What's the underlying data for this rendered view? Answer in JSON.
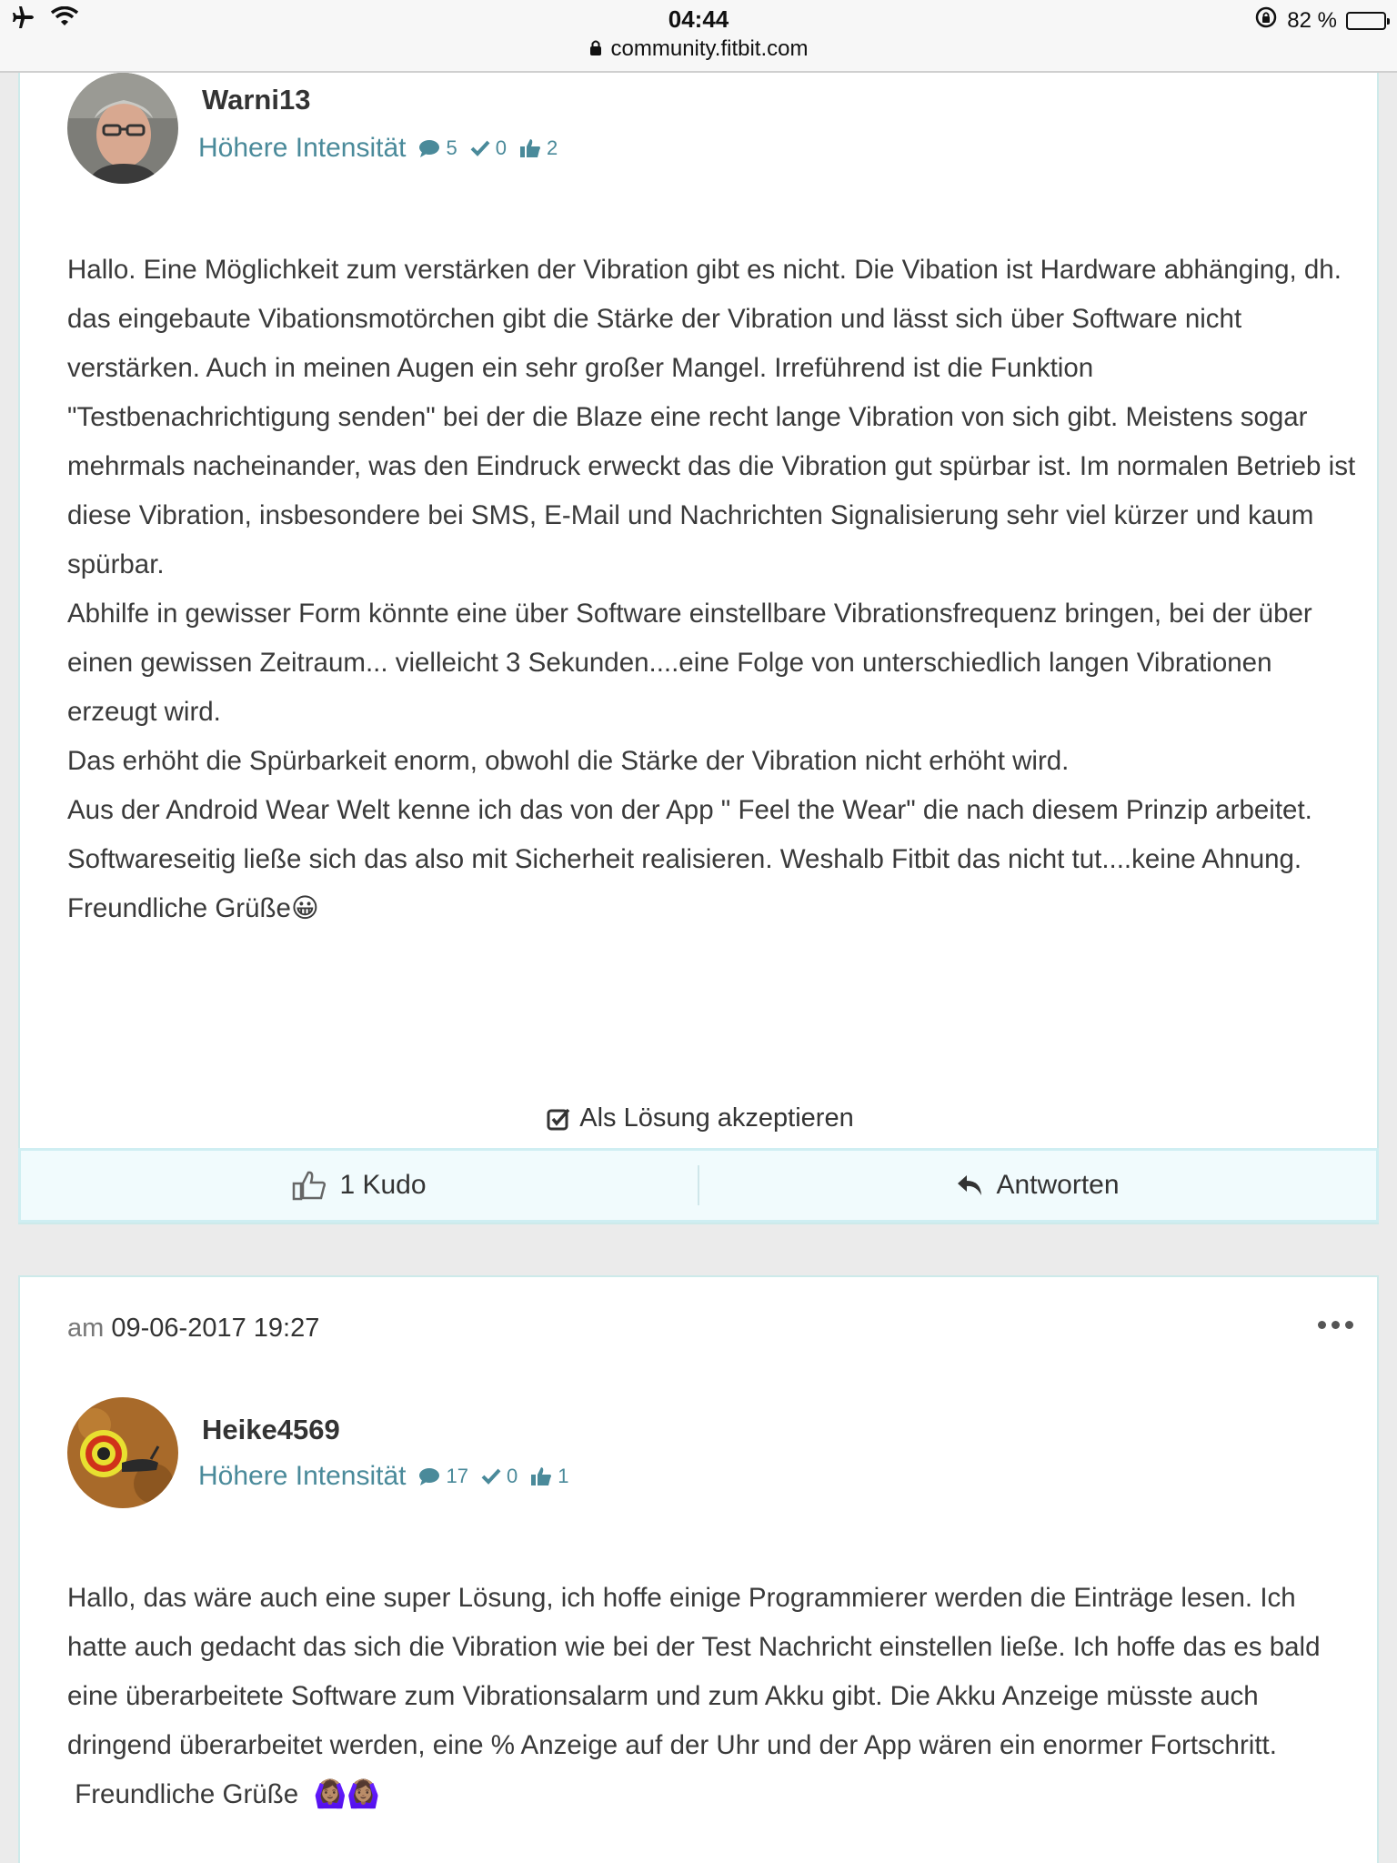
{
  "status_bar": {
    "time": "04:44",
    "url": "community.fitbit.com",
    "battery": "82 %",
    "battery_level": 0.82
  },
  "post1": {
    "username": "Warni13",
    "rank": "Höhere Intensität",
    "stats": {
      "messages": "5",
      "solutions": "0",
      "kudos": "2"
    },
    "body": [
      "Hallo. Eine Möglichkeit zum verstärken der Vibration gibt es nicht. Die Vibation ist Hardware abhänging, dh. das eingebaute Vibationsmotörchen gibt die Stärke der Vibration und lässt sich über Software nicht verstärken. Auch in meinen Augen ein sehr großer Mangel. Irreführend ist die Funktion \"Testbenachrichtigung senden\" bei der die Blaze eine recht lange Vibration von sich gibt. Meistens sogar mehrmals nacheinander, was den Eindruck erweckt das die Vibration gut spürbar ist. Im normalen Betrieb ist diese Vibration, insbesondere bei SMS, E-Mail und Nachrichten Signalisierung sehr viel kürzer und kaum spürbar.",
      "Abhilfe in gewisser Form könnte eine über Software einstellbare Vibrationsfrequenz bringen, bei der über einen gewissen Zeitraum... vielleicht 3 Sekunden....eine Folge von unterschiedlich langen Vibrationen erzeugt wird.",
      "Das erhöht die Spürbarkeit enorm, obwohl die Stärke der Vibration nicht erhöht wird.",
      "Aus der Android Wear Welt kenne ich das von der App \" Feel the Wear\" die nach diesem Prinzip arbeitet.",
      "Softwareseitig ließe sich das also mit Sicherheit realisieren. Weshalb Fitbit das nicht tut....keine Ahnung.",
      "Freundliche Grüße😀"
    ],
    "accept_label": "Als Lösung akzeptieren",
    "kudo_label": "1 Kudo",
    "reply_label": "Antworten"
  },
  "post2": {
    "date_prefix": "am",
    "date": "09-06-2017 19:27",
    "username": "Heike4569",
    "rank": "Höhere Intensität",
    "stats": {
      "messages": "17",
      "solutions": "0",
      "kudos": "1"
    },
    "body": [
      "Hallo, das wäre auch eine super Lösung, ich hoffe einige Programmierer werden die Einträge lesen. Ich hatte auch gedacht das sich die Vibration wie bei der Test Nachricht einstellen ließe. Ich hoffe das es bald eine überarbeitete Software zum Vibrationsalarm und zum Akku gibt. Die Akku Anzeige müsste auch dringend überarbeitet werden, eine % Anzeige auf der Uhr und der App wären ein enormer Fortschritt.",
      " Freundliche Grüße  🙆🏽‍♀️🙆🏽‍♀️"
    ]
  }
}
